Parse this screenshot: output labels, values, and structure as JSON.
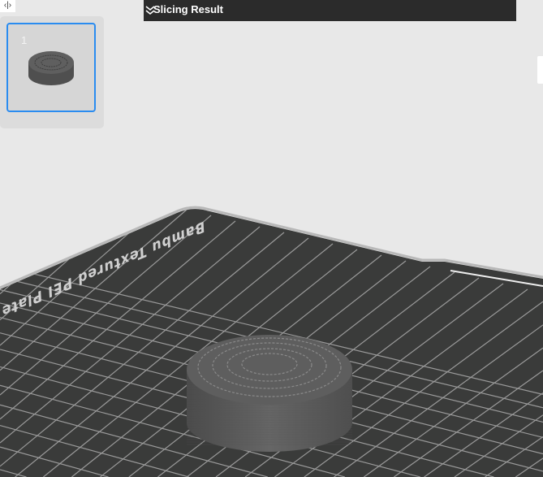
{
  "toolbar": {
    "collapse_toggle": "‹|›"
  },
  "plates": [
    {
      "number": "1",
      "selected": true
    }
  ],
  "slicing_result": {
    "title": "Slicing Result",
    "expand_icon": "double-chevron-down-icon"
  },
  "bed": {
    "label": "Bambu Textured PEI Plate"
  },
  "colors": {
    "accent": "#2a8cf0",
    "bed": "#3a3b3a",
    "grid": "#9a9a9a",
    "model": "#5c5c5c",
    "background": "#e8e8e8"
  }
}
